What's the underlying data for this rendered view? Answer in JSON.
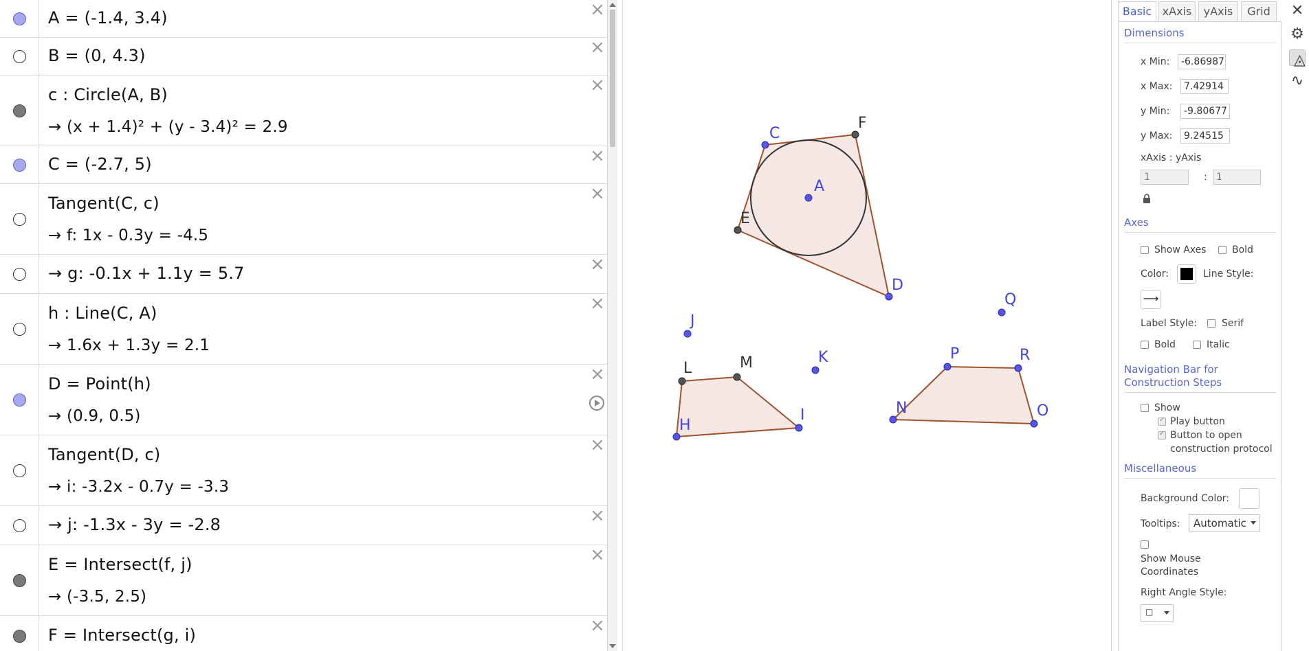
{
  "algebra": {
    "rows": [
      {
        "marble": "blue",
        "line1": "A = (-1.4, 3.4)",
        "line2": ""
      },
      {
        "marble": "off",
        "line1": "B = (0, 4.3)",
        "line2": ""
      },
      {
        "marble": "gray",
        "line1": "c : Circle(A, B)",
        "line2": "→ (x + 1.4)² + (y - 3.4)² = 2.9"
      },
      {
        "marble": "blue",
        "line1": "C = (-2.7, 5)",
        "line2": ""
      },
      {
        "marble": "off",
        "line1": "Tangent(C, c)",
        "line2": "→ f: 1x - 0.3y = -4.5"
      },
      {
        "marble": "off",
        "line1": "→ g: -0.1x + 1.1y = 5.7",
        "line2": ""
      },
      {
        "marble": "off",
        "line1": "h : Line(C, A)",
        "line2": "→ 1.6x + 1.3y = 2.1"
      },
      {
        "marble": "blue",
        "line1": "D = Point(h)",
        "line2": "→ (0.9, 0.5)"
      },
      {
        "marble": "off",
        "line1": "Tangent(D, c)",
        "line2": "→ i: -3.2x - 0.7y = -3.3"
      },
      {
        "marble": "off",
        "line1": "→ j: -1.3x - 3y = -2.8",
        "line2": ""
      },
      {
        "marble": "gray",
        "line1": "E = Intersect(f, j)",
        "line2": "→ (-3.5, 2.5)"
      },
      {
        "marble": "gray",
        "line1": "F = Intersect(g, i)",
        "line2": ""
      }
    ],
    "close_glyph": "×"
  },
  "graphics": {
    "points": [
      {
        "label": "A",
        "color": "#4444dd"
      },
      {
        "label": "C",
        "color": "#4444dd"
      },
      {
        "label": "F",
        "color": "#333333"
      },
      {
        "label": "E",
        "color": "#333333"
      },
      {
        "label": "D",
        "color": "#4444dd"
      },
      {
        "label": "J",
        "color": "#4444dd"
      },
      {
        "label": "Q",
        "color": "#4444dd"
      },
      {
        "label": "L",
        "color": "#333333"
      },
      {
        "label": "M",
        "color": "#333333"
      },
      {
        "label": "K",
        "color": "#4444dd"
      },
      {
        "label": "H",
        "color": "#4444dd"
      },
      {
        "label": "I",
        "color": "#4444dd"
      },
      {
        "label": "P",
        "color": "#4444dd"
      },
      {
        "label": "R",
        "color": "#4444dd"
      },
      {
        "label": "N",
        "color": "#4444dd"
      },
      {
        "label": "O",
        "color": "#4444dd"
      }
    ],
    "polygon_fill": "#f5e8e4",
    "polygon_stroke": "#a0522d"
  },
  "settings": {
    "tabs": [
      "Basic",
      "xAxis",
      "yAxis",
      "Grid"
    ],
    "dimensions_title": "Dimensions",
    "xmin_label": "x Min:",
    "xmin_value": "-6.86987",
    "xmax_label": "x Max:",
    "xmax_value": "7.42914",
    "ymin_label": "y Min:",
    "ymin_value": "-9.80677",
    "ymax_label": "y Max:",
    "ymax_value": "9.24515",
    "ratio_label": "xAxis : yAxis",
    "ratio_x": "1",
    "ratio_sep": ":",
    "ratio_y": "1",
    "axes_title": "Axes",
    "show_axes": "Show Axes",
    "bold": "Bold",
    "color_label": "Color:",
    "axes_color": "#000000",
    "line_style_label": "Line Style:",
    "line_style_glyph": "⟶",
    "label_style_label": "Label Style:",
    "serif": "Serif",
    "bold2": "Bold",
    "italic": "Italic",
    "nav_title_1": "Navigation Bar for",
    "nav_title_2": "Construction Steps",
    "show": "Show",
    "play_button": "Play button",
    "open_protocol_1": "Button to open",
    "open_protocol_2": "construction protocol",
    "misc_title": "Miscellaneous",
    "bg_color_label": "Background Color:",
    "tooltips_label": "Tooltips:",
    "tooltips_value": "Automatic",
    "mouse_coords_1": "Show Mouse",
    "mouse_coords_2": "Coordinates",
    "right_angle_label": "Right Angle Style:",
    "right_angle_value": "□"
  },
  "sidebar": {
    "close": "✕",
    "gear": "⚙",
    "graphics": "◬",
    "function": "∿"
  }
}
